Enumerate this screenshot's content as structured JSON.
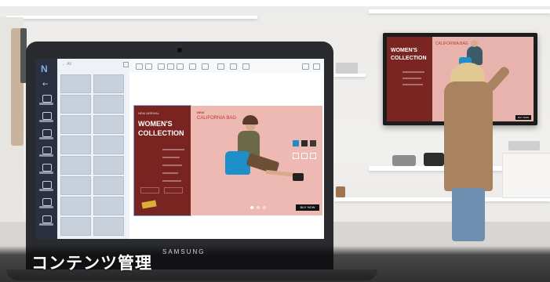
{
  "caption": "コンテンツ管理",
  "laptop": {
    "brand": "SAMSUNG",
    "app": {
      "logo": "N",
      "panel_header": "← All",
      "rail_items": [
        {
          "label": "TEMPLATE"
        },
        {
          "label": "MEDIA"
        },
        {
          "label": "TEXT"
        },
        {
          "label": "SHAPE"
        },
        {
          "label": "WIDGETS"
        },
        {
          "label": "FRAMES"
        },
        {
          "label": "BACKGROUND"
        },
        {
          "label": "CLOUD"
        }
      ],
      "slide": {
        "tag": "NEW ARRIVAL",
        "title_line1": "WOMEN'S",
        "title_line2": "COLLECTION",
        "product_tag": "NEW",
        "product_name": "CALIFORNIA BAG",
        "cta": "BUY NOW"
      }
    }
  },
  "wall_display": {
    "title_line1": "WOMEN'S",
    "title_line2": "COLLECTION",
    "product_name": "CALIFORNIA BAG",
    "cta": "BUY NOW"
  },
  "colors": {
    "slide_red": "#7a2421",
    "slide_pink": "#edb9b2",
    "swatch_blue": "#1e8fc9",
    "caption_bg": "#0a0a0c"
  },
  "icons": [
    "menu-icon",
    "back-arrow-icon",
    "template-icon",
    "media-icon",
    "text-icon",
    "shape-icon",
    "widget-icon",
    "frame-icon",
    "background-icon",
    "cloud-icon"
  ]
}
